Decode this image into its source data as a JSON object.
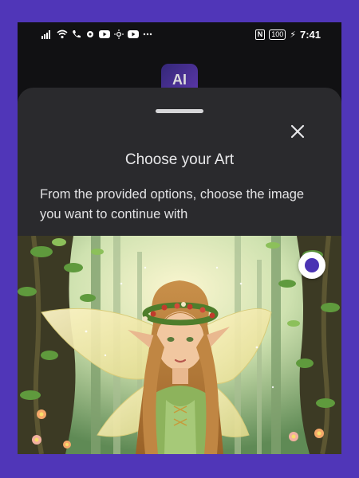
{
  "status_bar": {
    "left_icons": [
      "signal-icon",
      "wifi-icon",
      "call-icon",
      "settings-icon",
      "youtube-icon",
      "brightness-icon",
      "youtube-icon",
      "more-icon"
    ],
    "nfc_label": "N",
    "battery": "100",
    "time": "7:41"
  },
  "app": {
    "logo_text": "AI"
  },
  "sheet": {
    "title": "Choose your Art",
    "description": "From the provided options, choose the image you want to continue with",
    "close_icon": "close-icon"
  },
  "art_option": {
    "selected": true,
    "accent_color": "#4a33b3"
  }
}
